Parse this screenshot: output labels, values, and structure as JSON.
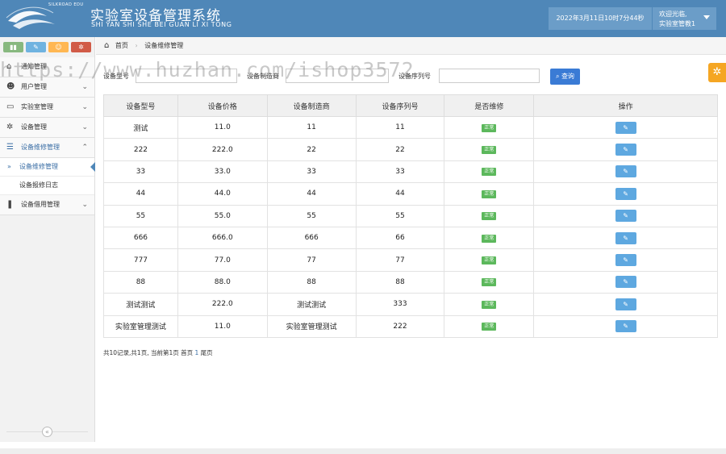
{
  "header": {
    "logo_text": "SILKROAD EDU",
    "title": "实验室设备管理系统",
    "subtitle": "SHI YAN SHI SHE BEI GUAN LI XI TONG",
    "datetime": "2022年3月11日10时7分44秒",
    "welcome": "欢迎光临,",
    "username": "实验室管教1"
  },
  "sidebar": {
    "shortcuts": [
      {
        "icon": "signal-icon",
        "glyph": "▮",
        "color": "#87b87f"
      },
      {
        "icon": "pencil-icon",
        "glyph": "✎",
        "color": "#6fb3e0"
      },
      {
        "icon": "users-icon",
        "glyph": "☺",
        "color": "#ffb752"
      },
      {
        "icon": "cogs-icon",
        "glyph": "✲",
        "color": "#d15b47"
      }
    ],
    "items": [
      {
        "label": "通知管理",
        "icon": "home-icon"
      },
      {
        "label": "用户管理",
        "icon": "users-icon"
      },
      {
        "label": "实验室管理",
        "icon": "desktop-icon"
      },
      {
        "label": "设备管理",
        "icon": "cogs-icon"
      },
      {
        "label": "设备维修管理",
        "icon": "list-icon"
      },
      {
        "label": "设备借用管理",
        "icon": "bookmark-icon"
      }
    ],
    "sub_items": [
      {
        "label": "设备维修管理"
      },
      {
        "label": "设备报修日志"
      }
    ]
  },
  "breadcrumb": {
    "home": "首页",
    "current": "设备维修管理"
  },
  "search": {
    "model_label": "设备型号",
    "maker_label": "设备制造商",
    "serial_label": "设备序列号",
    "query_label": "查询"
  },
  "table": {
    "headers": [
      "设备型号",
      "设备价格",
      "设备制造商",
      "设备序列号",
      "是否维修",
      "操作"
    ],
    "rows": [
      {
        "model": "测试",
        "price": "11.0",
        "maker": "11",
        "serial": "11",
        "status": "正常"
      },
      {
        "model": "222",
        "price": "222.0",
        "maker": "22",
        "serial": "22",
        "status": "正常"
      },
      {
        "model": "33",
        "price": "33.0",
        "maker": "33",
        "serial": "33",
        "status": "正常"
      },
      {
        "model": "44",
        "price": "44.0",
        "maker": "44",
        "serial": "44",
        "status": "正常"
      },
      {
        "model": "55",
        "price": "55.0",
        "maker": "55",
        "serial": "55",
        "status": "正常"
      },
      {
        "model": "666",
        "price": "666.0",
        "maker": "666",
        "serial": "66",
        "status": "正常"
      },
      {
        "model": "777",
        "price": "77.0",
        "maker": "77",
        "serial": "77",
        "status": "正常"
      },
      {
        "model": "88",
        "price": "88.0",
        "maker": "88",
        "serial": "88",
        "status": "正常"
      },
      {
        "model": "测试测试",
        "price": "222.0",
        "maker": "测试测试",
        "serial": "333",
        "status": "正常"
      },
      {
        "model": "实验室管理测试",
        "price": "11.0",
        "maker": "实验室管理测试",
        "serial": "222",
        "status": "正常"
      }
    ]
  },
  "pager": {
    "summary": "共10记录,共1页, 当前第1页 首页 ",
    "page": "1",
    "last": " 尾页"
  },
  "watermark": "https://www.huzhan.com/ishop3572"
}
